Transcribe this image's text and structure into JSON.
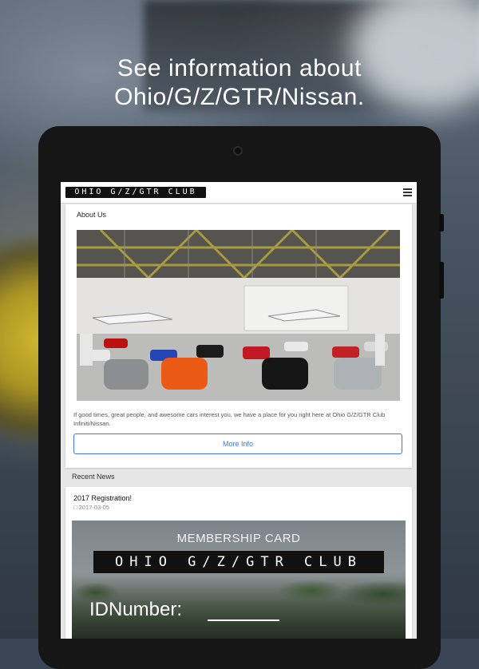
{
  "promo": {
    "headline_line1": "See information about",
    "headline_line2": "Ohio/G/Z/GTR/Nissan."
  },
  "app": {
    "logo_text": "OHIO G/Z/GTR CLUB",
    "menu_icon": "hamburger-menu-icon"
  },
  "about": {
    "title": "About Us",
    "image_icon": "hangar-cars-photo",
    "text": "If good times, great people, and awesome cars interest you, we have a place for you right here at Ohio G/Z/GTR Club Infiniti/Nissan.",
    "button_label": "More Info"
  },
  "news": {
    "section_label": "Recent News",
    "items": [
      {
        "title": "2017 Registration!",
        "date": "2017-03-05",
        "date_icon": "calendar-icon",
        "image": {
          "heading": "MEMBERSHIP CARD",
          "logo_text": "OHIO G/Z/GTR CLUB",
          "id_label": "IDNumber:"
        }
      }
    ]
  },
  "colors": {
    "accent": "#3f78e0",
    "card_bg": "#ffffff",
    "screen_bg": "#e6e6e6"
  }
}
